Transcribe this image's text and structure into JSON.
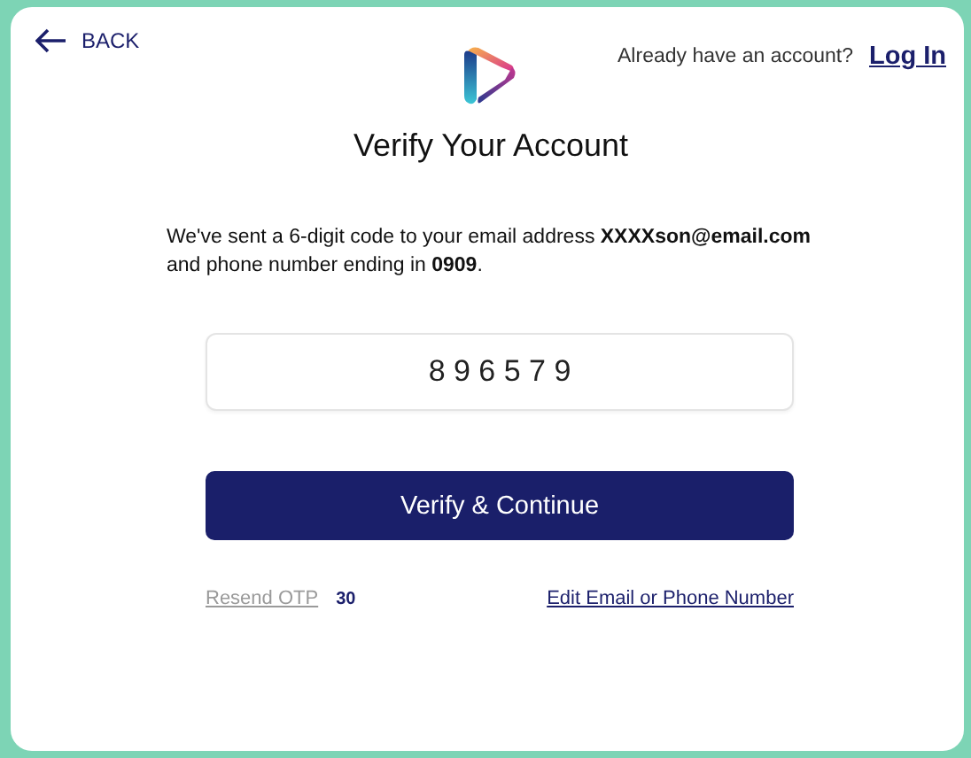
{
  "back": {
    "label": "BACK"
  },
  "login_prompt": {
    "text": "Already have an account?",
    "link": "Log In"
  },
  "title": "Verify Your Account",
  "message": "We've sent a 6-digit code to your email address **XXXXson@email.com** and phone number ending in **0909**.",
  "otp_field": {
    "value": "8 9 6 5 7 9"
  },
  "submit_button": "Verify & Continue",
  "resend": {
    "label": "Resend OTP",
    "disabled": true,
    "countdown": "30"
  },
  "edit_link": "Edit Email or Phone Number"
}
